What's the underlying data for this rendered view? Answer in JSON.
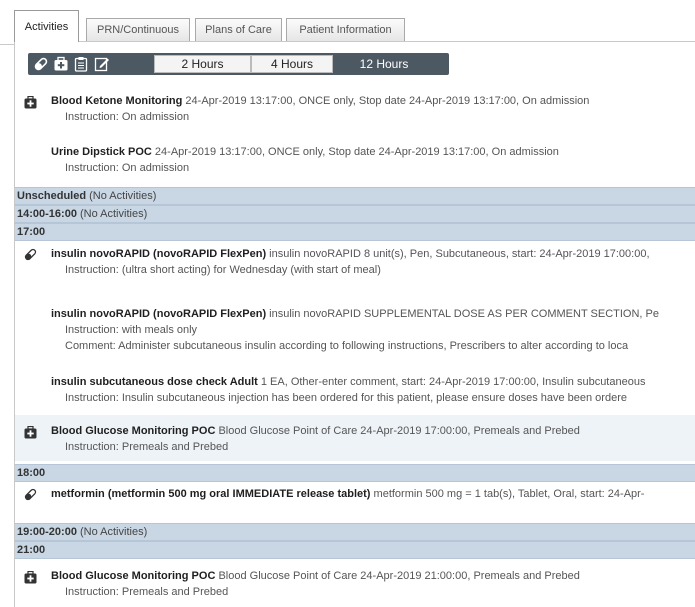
{
  "tabs": [
    "Activities",
    "PRN/Continuous",
    "Plans of Care",
    "Patient Information"
  ],
  "hours": [
    "2 Hours",
    "4 Hours",
    "12 Hours"
  ],
  "entries": {
    "ketone": {
      "name": "Blood Ketone Monitoring",
      "detail": " 24-Apr-2019 13:17:00, ONCE only, Stop date 24-Apr-2019 13:17:00, On admission",
      "instruction": "Instruction: On admission"
    },
    "urine": {
      "name": "Urine Dipstick POC",
      "detail": " 24-Apr-2019 13:17:00, ONCE only, Stop date 24-Apr-2019 13:17:00, On admission",
      "instruction": "Instruction: On admission"
    },
    "unscheduled": {
      "name": "Unscheduled",
      "detail": " (No Activities)"
    },
    "s1400": {
      "name": "14:00-16:00",
      "detail": " (No Activities)"
    },
    "s1700": {
      "name": "17:00"
    },
    "insulin1": {
      "name": "insulin novoRAPID (novoRAPID FlexPen)",
      "detail": " insulin novoRAPID 8 unit(s), Pen, Subcutaneous, start: 24-Apr-2019 17:00:00,",
      "instruction": "Instruction: (ultra short acting) for Wednesday (with start of meal)"
    },
    "insulin2": {
      "name": "insulin novoRAPID (novoRAPID FlexPen)",
      "detail": " insulin novoRAPID SUPPLEMENTAL DOSE AS PER COMMENT SECTION, Pe",
      "instruction": "Instruction: with meals only",
      "comment": "Comment: Administer subcutaneous insulin according to following instructions, Prescribers to alter according to loca"
    },
    "insulin3": {
      "name": "insulin subcutaneous dose check Adult",
      "detail": " 1 EA, Other-enter comment, start: 24-Apr-2019 17:00:00, Insulin subcutaneous",
      "instruction": "Instruction: Insulin subcutaneous injection has been ordered for this patient, please ensure doses have been ordere"
    },
    "glucose1": {
      "name": "Blood Glucose Monitoring POC",
      "detail": " Blood Glucose Point of Care 24-Apr-2019 17:00:00, Premeals and Prebed",
      "instruction": "Instruction: Premeals and Prebed"
    },
    "s1800": {
      "name": "18:00"
    },
    "metformin": {
      "name": "metformin (metformin 500 mg oral IMMEDIATE release tablet)",
      "detail": " metformin 500 mg = 1 tab(s), Tablet, Oral, start: 24-Apr-"
    },
    "s1900": {
      "name": "19:00-20:00",
      "detail": " (No Activities)"
    },
    "s2100": {
      "name": "21:00"
    },
    "glucose2": {
      "name": "Blood Glucose Monitoring POC",
      "detail": " Blood Glucose Point of Care 24-Apr-2019 21:00:00, Premeals and Prebed",
      "instruction": "Instruction: Premeals and Prebed"
    }
  }
}
